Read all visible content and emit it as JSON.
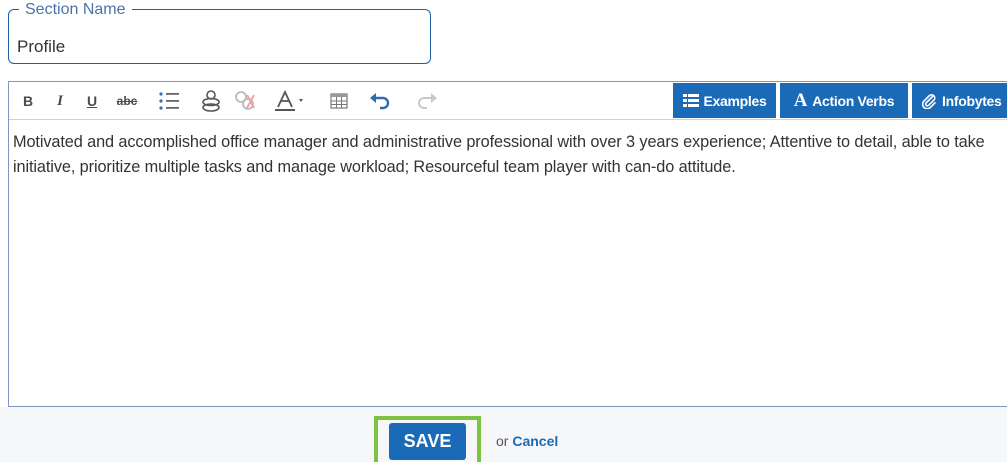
{
  "section": {
    "legend": "Section Name",
    "value": "Profile"
  },
  "toolbar": {
    "bold_label": "B",
    "italic_label": "I",
    "underline_label": "U",
    "strike_label": "abc",
    "icons": [
      "bold-icon",
      "italic-icon",
      "underline-icon",
      "strikethrough-icon",
      "bulleted-list-icon",
      "link-icon",
      "unlink-icon",
      "font-color-icon",
      "table-icon",
      "undo-icon",
      "redo-icon"
    ],
    "examples_label": "Examples",
    "action_verbs_label": "Action Verbs",
    "action_verbs_glyph": "A",
    "infobytes_label": "Infobytes"
  },
  "editor": {
    "content": "Motivated and accomplished office manager and administrative professional with over 3 years experience; Attentive to detail, able to take initiative, prioritize multiple tasks and manage workload; Resourceful team player with can-do attitude."
  },
  "footer": {
    "save_label": "SAVE",
    "or_text": "or",
    "cancel_label": "Cancel"
  },
  "colors": {
    "accent": "#1b6ab8",
    "highlight": "#7dc242",
    "field_border": "#1f5fa6"
  }
}
